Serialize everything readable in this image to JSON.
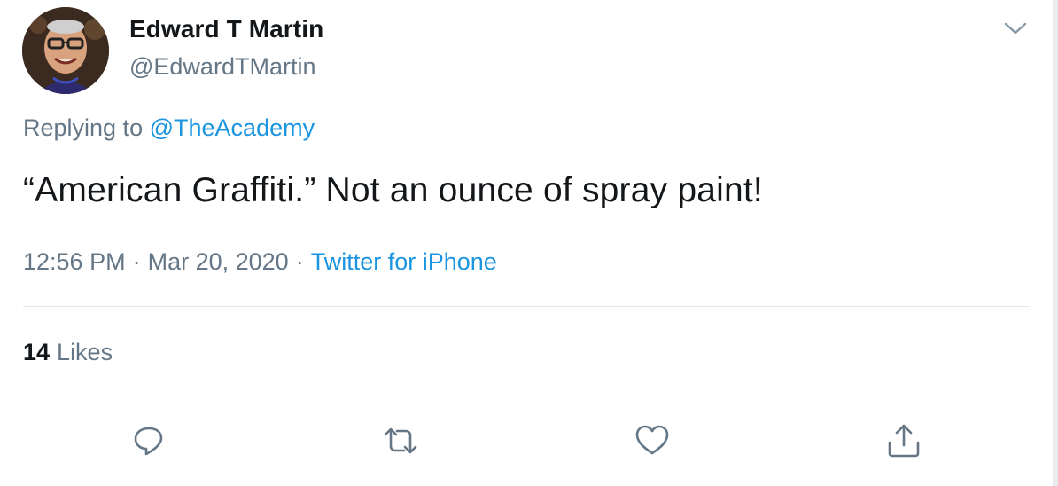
{
  "author": {
    "display_name": "Edward T Martin",
    "handle": "@EdwardTMartin"
  },
  "reply": {
    "prefix": "Replying to",
    "target": "@TheAcademy"
  },
  "tweet": {
    "text": "“American Graffiti.” Not an ounce of spray paint!"
  },
  "meta": {
    "time": "12:56 PM",
    "separator": "·",
    "date": "Mar 20, 2020",
    "source": "Twitter for iPhone"
  },
  "stats": {
    "likes_count": "14",
    "likes_label": "Likes"
  },
  "actions": {
    "reply_icon": "reply-icon",
    "retweet_icon": "retweet-icon",
    "like_icon": "heart-icon",
    "share_icon": "share-icon"
  },
  "colors": {
    "text": "#14171a",
    "secondary": "#657786",
    "link": "#1b95e0",
    "divider": "#e1e8ed"
  }
}
